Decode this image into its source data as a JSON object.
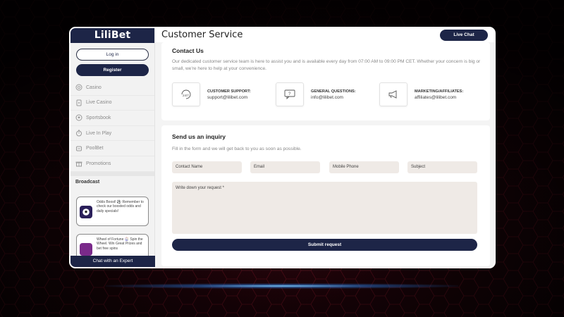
{
  "brand": {
    "logo_text": "LiliBet",
    "primary_color": "#1d2547"
  },
  "sidebar": {
    "login_label": "Log in",
    "register_label": "Register",
    "items": [
      {
        "label": "Casino",
        "icon": "casino-chip-icon"
      },
      {
        "label": "Live Casino",
        "icon": "live-casino-icon"
      },
      {
        "label": "Sportsbook",
        "icon": "soccer-ball-icon"
      },
      {
        "label": "Live In Play",
        "icon": "stopwatch-icon"
      },
      {
        "label": "PoolBet",
        "icon": "poolbet-icon"
      },
      {
        "label": "Promotions",
        "icon": "gift-icon"
      }
    ],
    "broadcast_title": "Broadcast",
    "broadcast_cards": [
      {
        "text": "Odds Boost! ⚽ Remember to check our boosted odds and daily specials!",
        "icon": "soccer-ball-icon"
      },
      {
        "text": "Wheel of Fortune 🎡 Spin the Wheel. Win Great Prizes and bet free spins",
        "icon": "wheel-icon"
      }
    ],
    "chat_expert_label": "Chat with an Expert"
  },
  "header": {
    "title": "Customer Service",
    "live_chat_label": "Live Chat"
  },
  "contact": {
    "title": "Contact Us",
    "intro": "Our dedicated customer service team is here to assist you and is available every day from 07:00 AM to 09:00 PM CET. Whether your concern is big or small, we're here to help at your convenience.",
    "items": [
      {
        "title": "CUSTOMER SUPPORT:",
        "value": "support@lilibet.com",
        "icon": "support-24-7-icon"
      },
      {
        "title": "GENERAL QUESTIONS:",
        "value": "info@lilibet.com",
        "icon": "question-bubble-icon"
      },
      {
        "title": "MARKETING/AFFILIATES:",
        "value": "affiliates@lilibet.com",
        "icon": "megaphone-icon"
      }
    ]
  },
  "inquiry": {
    "title": "Send us an inquiry",
    "subtitle": "Fill in the form and we will get back to you as soon as possible.",
    "fields": {
      "contact_name": "Contact Name",
      "email": "Email",
      "mobile_phone": "Mobile Phone",
      "subject": "Subject"
    },
    "request_placeholder": "Write down your request *",
    "submit_label": "Submit request"
  }
}
